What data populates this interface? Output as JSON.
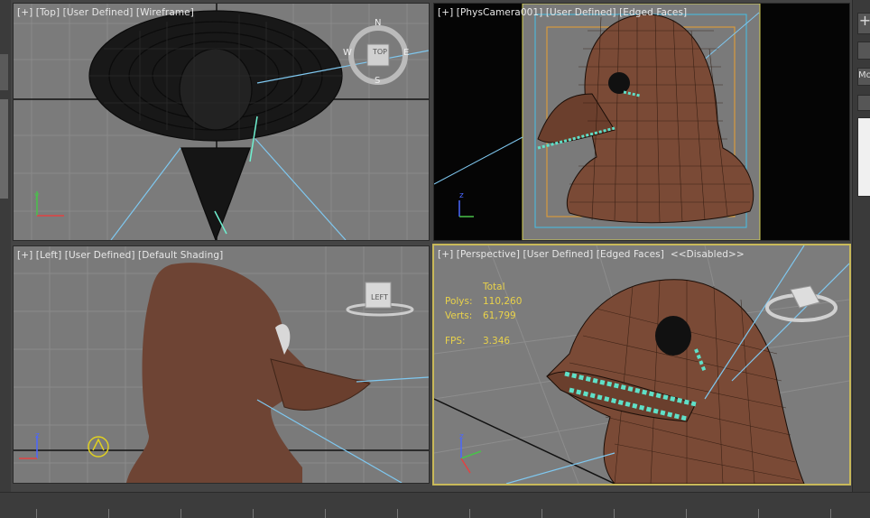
{
  "viewports": {
    "top": {
      "label": {
        "p1": "[+]",
        "p2": "[Top]",
        "p3": "[User Defined]",
        "p4": "[Wireframe]"
      },
      "compass": {
        "n": "N",
        "s": "S",
        "e": "E",
        "w": "W",
        "cube": "TOP"
      }
    },
    "camera": {
      "label": {
        "p1": "[+]",
        "p2": "[PhysCamera001]",
        "p3": "[User Defined]",
        "p4": "[Edged Faces]"
      }
    },
    "left": {
      "label": {
        "p1": "[+]",
        "p2": "[Left]",
        "p3": "[User Defined]",
        "p4": "[Default Shading]"
      },
      "cube": "LEFT"
    },
    "perspective": {
      "label": {
        "p1": "[+]",
        "p2": "[Perspective]",
        "p3": "[User Defined]",
        "p4": "[Edged Faces]",
        "p5": "<<Disabled>>"
      },
      "stats": {
        "total": "Total",
        "polys_label": "Polys:",
        "polys_value": "110,260",
        "verts_label": "Verts:",
        "verts_value": "61,799",
        "fps_label": "FPS:",
        "fps_value": "3.346"
      }
    }
  },
  "right_panel": {
    "plus": "+",
    "tab": "Mo"
  },
  "colors": {
    "wire": "#0a0a0a",
    "grid": "#7c7c7c",
    "active_border": "#c8b95a",
    "mask": "#c66f3d",
    "stitch": "#5fe0c8",
    "bg_viewport": "#7d7d7d",
    "bg_camera": "#050505"
  }
}
